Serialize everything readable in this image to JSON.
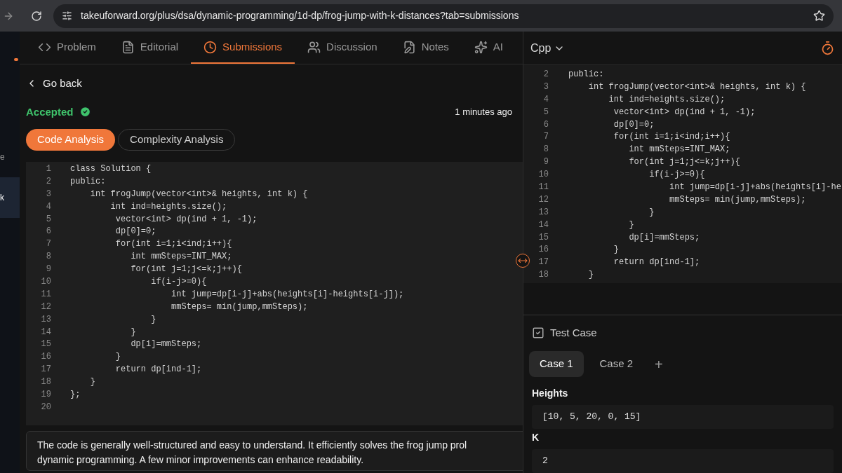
{
  "browser": {
    "url": "takeuforward.org/plus/dsa/dynamic-programming/1d-dp/frog-jump-with-k-distances?tab=submissions"
  },
  "sidebar": {
    "items": [
      {
        "label": "e",
        "selected": false
      },
      {
        "label": "k",
        "selected": true
      }
    ]
  },
  "tabs": [
    {
      "label": "Problem",
      "kind": "code",
      "selected": false
    },
    {
      "label": "Editorial",
      "kind": "file",
      "selected": false
    },
    {
      "label": "Submissions",
      "kind": "clock",
      "selected": true
    },
    {
      "label": "Discussion",
      "kind": "users",
      "selected": false
    },
    {
      "label": "Notes",
      "kind": "notes",
      "selected": false
    },
    {
      "label": "AI",
      "kind": "sparkles",
      "selected": false
    }
  ],
  "back_link": "Go back",
  "submission": {
    "status": "Accepted",
    "time": "1 minutes ago"
  },
  "analysis_tabs": [
    {
      "label": "Code Analysis",
      "selected": true
    },
    {
      "label": "Complexity Analysis",
      "selected": false
    }
  ],
  "code": {
    "lines": [
      {
        "n": "1",
        "text": "class Solution {"
      },
      {
        "n": "2",
        "text": "public:"
      },
      {
        "n": "3",
        "text": "    int frogJump(vector<int>& heights, int k) {"
      },
      {
        "n": "4",
        "text": "        int ind=heights.size();"
      },
      {
        "n": "5",
        "text": "         vector<int> dp(ind + 1, -1);"
      },
      {
        "n": "6",
        "text": "         dp[0]=0;"
      },
      {
        "n": "7",
        "text": "         for(int i=1;i<ind;i++){"
      },
      {
        "n": "8",
        "text": "            int mmSteps=INT_MAX;"
      },
      {
        "n": "9",
        "text": "            for(int j=1;j<=k;j++){"
      },
      {
        "n": "10",
        "text": "                if(i-j>=0){"
      },
      {
        "n": "11",
        "text": "                    int jump=dp[i-j]+abs(heights[i]-heights[i-j]);"
      },
      {
        "n": "12",
        "text": "                    mmSteps= min(jump,mmSteps);"
      },
      {
        "n": "13",
        "text": "                }"
      },
      {
        "n": "14",
        "text": "            }"
      },
      {
        "n": "15",
        "text": "            dp[i]=mmSteps;"
      },
      {
        "n": "16",
        "text": "         }"
      },
      {
        "n": "17",
        "text": "         return dp[ind-1];"
      },
      {
        "n": "18",
        "text": "    }"
      },
      {
        "n": "19",
        "text": "};"
      },
      {
        "n": "20"
      }
    ]
  },
  "summary_lines": [
    "The code is generally well-structured and easy to understand. It efficiently solves the frog jump prol",
    "dynamic programming. A few minor improvements can enhance readability."
  ],
  "editor": {
    "language": "Cpp",
    "lines": [
      {
        "n": "2",
        "text": "public:"
      },
      {
        "n": "3",
        "text": "    int frogJump(vector<int>& heights, int k) {"
      },
      {
        "n": "4",
        "text": "        int ind=heights.size();"
      },
      {
        "n": "5",
        "text": "         vector<int> dp(ind + 1, -1);"
      },
      {
        "n": "6",
        "text": "         dp[0]=0;"
      },
      {
        "n": "7",
        "text": "         for(int i=1;i<ind;i++){"
      },
      {
        "n": "8",
        "text": "            int mmSteps=INT_MAX;"
      },
      {
        "n": "9",
        "text": "            for(int j=1;j<=k;j++){"
      },
      {
        "n": "10",
        "text": "                if(i-j>=0){"
      },
      {
        "n": "11",
        "text": "                    int jump=dp[i-j]+abs(heights[i]-he"
      },
      {
        "n": "12",
        "text": "                    mmSteps= min(jump,mmSteps);"
      },
      {
        "n": "13",
        "text": "                }"
      },
      {
        "n": "14",
        "text": "            }"
      },
      {
        "n": "15",
        "text": "            dp[i]=mmSteps;"
      },
      {
        "n": "16",
        "text": "         }"
      },
      {
        "n": "17",
        "text": "         return dp[ind-1];"
      },
      {
        "n": "18",
        "text": "    }"
      }
    ]
  },
  "test_case": {
    "title": "Test Case",
    "cases": [
      {
        "label": "Case 1",
        "selected": true
      },
      {
        "label": "Case 2",
        "selected": false
      }
    ],
    "add": "+",
    "inputs": [
      {
        "label": "Heights",
        "value": "[10, 5, 20, 0, 15]"
      },
      {
        "label": "K",
        "value": "2"
      }
    ]
  }
}
